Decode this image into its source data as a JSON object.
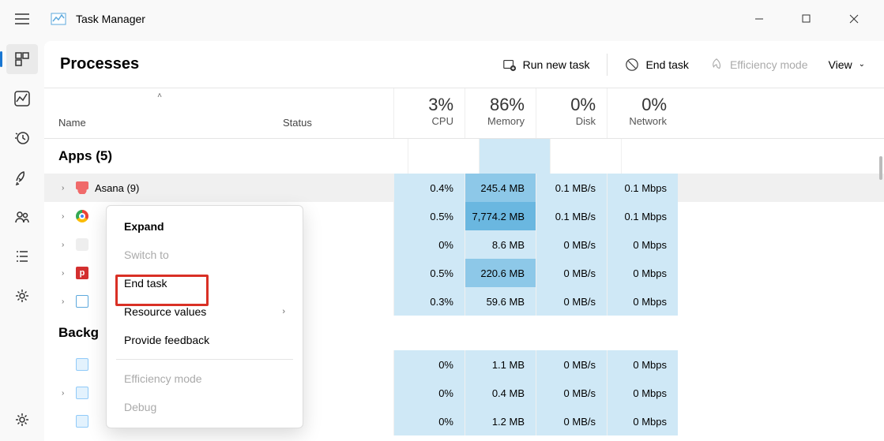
{
  "window": {
    "title": "Task Manager"
  },
  "toolbar": {
    "page_title": "Processes",
    "run_new_task": "Run new task",
    "end_task": "End task",
    "efficiency_mode": "Efficiency mode",
    "view": "View"
  },
  "columns": {
    "name": "Name",
    "status": "Status",
    "cpu": {
      "pct": "3%",
      "label": "CPU"
    },
    "memory": {
      "pct": "86%",
      "label": "Memory"
    },
    "disk": {
      "pct": "0%",
      "label": "Disk"
    },
    "network": {
      "pct": "0%",
      "label": "Network"
    }
  },
  "groups": {
    "apps": "Apps (5)",
    "background": "Backg"
  },
  "rows": [
    {
      "name": "Asana (9)",
      "cpu": "0.4%",
      "mem": "245.4 MB",
      "disk": "0.1 MB/s",
      "net": "0.1 Mbps",
      "mem_hl": "hl-2"
    },
    {
      "name": "",
      "cpu": "0.5%",
      "mem": "7,774.2 MB",
      "disk": "0.1 MB/s",
      "net": "0.1 Mbps",
      "mem_hl": "hl-3"
    },
    {
      "name": "",
      "cpu": "0%",
      "mem": "8.6 MB",
      "disk": "0 MB/s",
      "net": "0 Mbps",
      "mem_hl": "hl-1"
    },
    {
      "name": "",
      "cpu": "0.5%",
      "mem": "220.6 MB",
      "disk": "0 MB/s",
      "net": "0 Mbps",
      "mem_hl": "hl-2"
    },
    {
      "name": "",
      "cpu": "0.3%",
      "mem": "59.6 MB",
      "disk": "0 MB/s",
      "net": "0 Mbps",
      "mem_hl": "hl-1"
    }
  ],
  "bg_rows": [
    {
      "cpu": "0%",
      "mem": "1.1 MB",
      "disk": "0 MB/s",
      "net": "0 Mbps"
    },
    {
      "cpu": "0%",
      "mem": "0.4 MB",
      "disk": "0 MB/s",
      "net": "0 Mbps"
    },
    {
      "cpu": "0%",
      "mem": "1.2 MB",
      "disk": "0 MB/s",
      "net": "0 Mbps"
    }
  ],
  "context_menu": {
    "expand": "Expand",
    "switch_to": "Switch to",
    "end_task": "End task",
    "resource_values": "Resource values",
    "provide_feedback": "Provide feedback",
    "efficiency_mode": "Efficiency mode",
    "debug": "Debug"
  }
}
